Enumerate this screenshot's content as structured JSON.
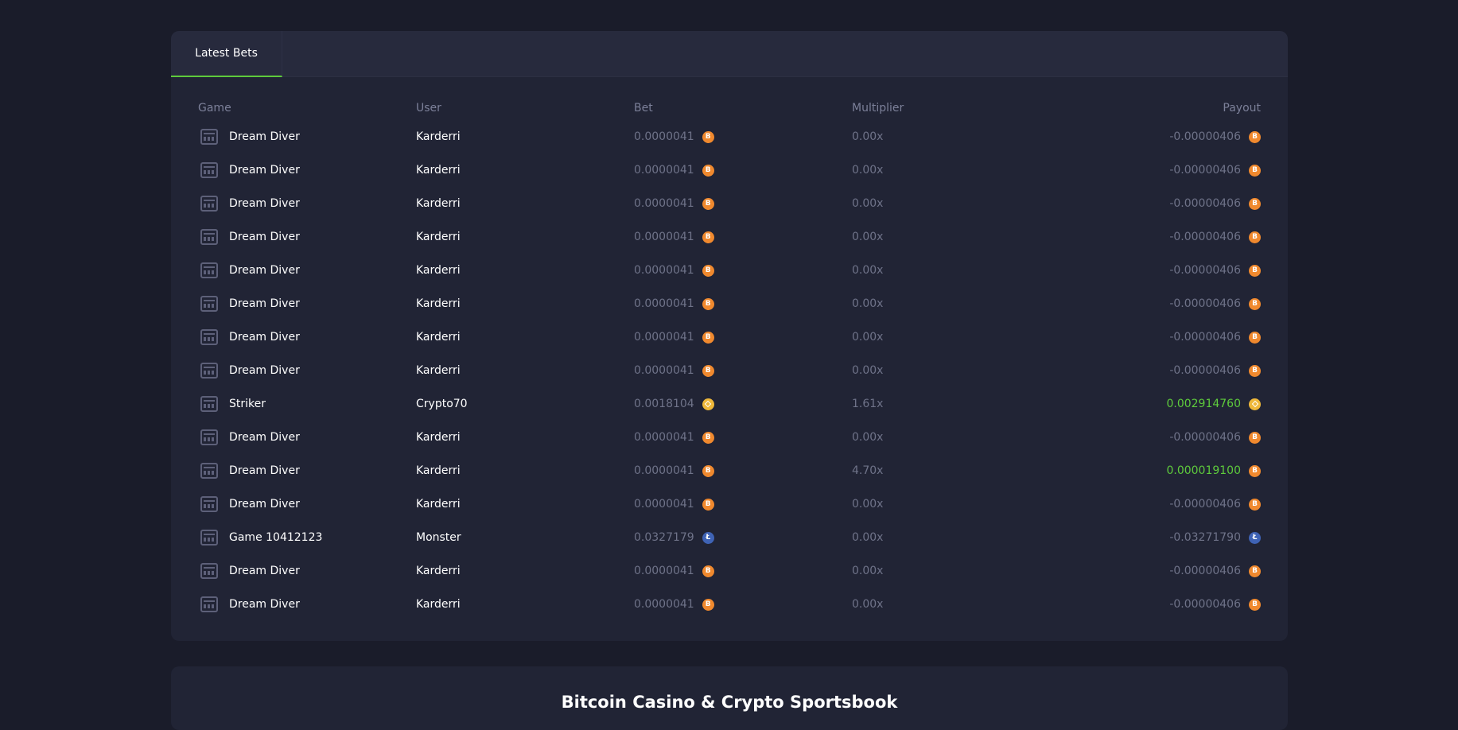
{
  "tabs": [
    {
      "label": "Latest Bets"
    }
  ],
  "columns": {
    "game": "Game",
    "user": "User",
    "bet": "Bet",
    "multiplier": "Multiplier",
    "payout": "Payout"
  },
  "rows": [
    {
      "game": "Dream Diver",
      "user": "Karderri",
      "bet": "0.0000041",
      "coin": "btc-icon",
      "multiplier": "0.00x",
      "payout": "-0.00000406",
      "win": false
    },
    {
      "game": "Dream Diver",
      "user": "Karderri",
      "bet": "0.0000041",
      "coin": "btc-icon",
      "multiplier": "0.00x",
      "payout": "-0.00000406",
      "win": false
    },
    {
      "game": "Dream Diver",
      "user": "Karderri",
      "bet": "0.0000041",
      "coin": "btc-icon",
      "multiplier": "0.00x",
      "payout": "-0.00000406",
      "win": false
    },
    {
      "game": "Dream Diver",
      "user": "Karderri",
      "bet": "0.0000041",
      "coin": "btc-icon",
      "multiplier": "0.00x",
      "payout": "-0.00000406",
      "win": false
    },
    {
      "game": "Dream Diver",
      "user": "Karderri",
      "bet": "0.0000041",
      "coin": "btc-icon",
      "multiplier": "0.00x",
      "payout": "-0.00000406",
      "win": false
    },
    {
      "game": "Dream Diver",
      "user": "Karderri",
      "bet": "0.0000041",
      "coin": "btc-icon",
      "multiplier": "0.00x",
      "payout": "-0.00000406",
      "win": false
    },
    {
      "game": "Dream Diver",
      "user": "Karderri",
      "bet": "0.0000041",
      "coin": "btc-icon",
      "multiplier": "0.00x",
      "payout": "-0.00000406",
      "win": false
    },
    {
      "game": "Dream Diver",
      "user": "Karderri",
      "bet": "0.0000041",
      "coin": "btc-icon",
      "multiplier": "0.00x",
      "payout": "-0.00000406",
      "win": false
    },
    {
      "game": "Striker",
      "user": "Crypto70",
      "bet": "0.0018104",
      "coin": "bnb-icon",
      "multiplier": "1.61x",
      "payout": "0.002914760",
      "win": true
    },
    {
      "game": "Dream Diver",
      "user": "Karderri",
      "bet": "0.0000041",
      "coin": "btc-icon",
      "multiplier": "0.00x",
      "payout": "-0.00000406",
      "win": false
    },
    {
      "game": "Dream Diver",
      "user": "Karderri",
      "bet": "0.0000041",
      "coin": "btc-icon",
      "multiplier": "4.70x",
      "payout": "0.000019100",
      "win": true
    },
    {
      "game": "Dream Diver",
      "user": "Karderri",
      "bet": "0.0000041",
      "coin": "btc-icon",
      "multiplier": "0.00x",
      "payout": "-0.00000406",
      "win": false
    },
    {
      "game": "Game 10412123",
      "user": "Monster",
      "bet": "0.0327179",
      "coin": "ltc-icon",
      "multiplier": "0.00x",
      "payout": "-0.03271790",
      "win": false
    },
    {
      "game": "Dream Diver",
      "user": "Karderri",
      "bet": "0.0000041",
      "coin": "btc-icon",
      "multiplier": "0.00x",
      "payout": "-0.00000406",
      "win": false
    },
    {
      "game": "Dream Diver",
      "user": "Karderri",
      "bet": "0.0000041",
      "coin": "btc-icon",
      "multiplier": "0.00x",
      "payout": "-0.00000406",
      "win": false
    }
  ],
  "colors": {
    "background": "#1a1c2a",
    "panel": "#212435",
    "win": "#5ecb3c",
    "btc": "#f0892e",
    "bnb": "#efb83a",
    "ltc": "#3f63b5"
  },
  "footer": {
    "title": "Bitcoin Casino & Crypto Sportsbook"
  }
}
